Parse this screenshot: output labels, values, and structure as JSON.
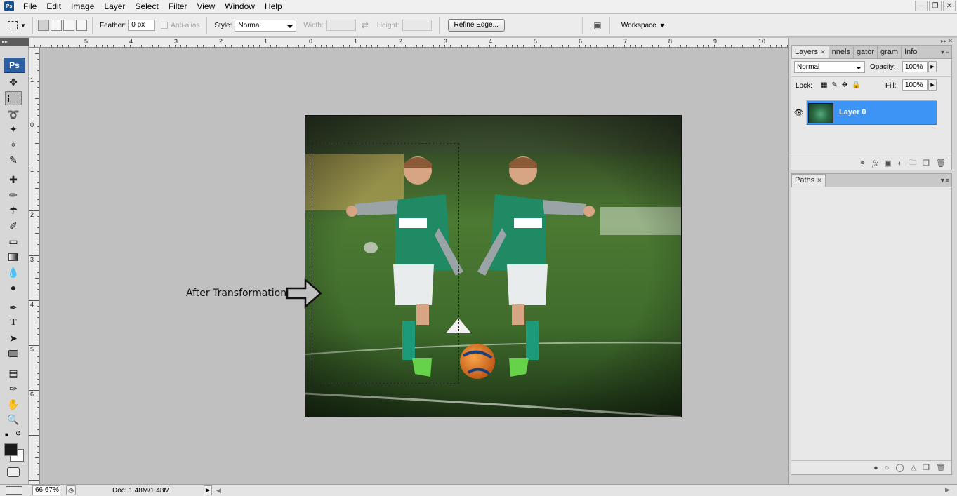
{
  "app": {
    "icon_label": "Ps"
  },
  "menu": [
    "File",
    "Edit",
    "Image",
    "Layer",
    "Select",
    "Filter",
    "View",
    "Window",
    "Help"
  ],
  "window_controls": [
    "minimize",
    "restore",
    "close"
  ],
  "options_bar": {
    "feather_label": "Feather:",
    "feather_value": "0 px",
    "antialias_label": "Anti-alias",
    "style_label": "Style:",
    "style_value": "Normal",
    "width_label": "Width:",
    "height_label": "Height:",
    "refine_label": "Refine Edge...",
    "workspace_label": "Workspace"
  },
  "toolbox": {
    "logo": "Ps",
    "tools": [
      "move-tool",
      "rectangular-marquee-tool",
      "lasso-tool",
      "magic-wand-tool",
      "crop-tool",
      "slice-tool",
      "healing-brush-tool",
      "brush-tool",
      "clone-stamp-tool",
      "history-brush-tool",
      "eraser-tool",
      "gradient-tool",
      "blur-tool",
      "dodge-tool",
      "pen-tool",
      "type-tool",
      "path-selection-tool",
      "shape-tool",
      "notes-tool",
      "eyedropper-tool",
      "hand-tool",
      "zoom-tool"
    ],
    "foreground_color": "#1a1a1a",
    "background_color": "#ffffff"
  },
  "rulers": {
    "top": [
      "5",
      "4",
      "3",
      "2",
      "1",
      "0",
      "1",
      "2",
      "3",
      "4",
      "5",
      "6",
      "7",
      "8",
      "9",
      "10"
    ],
    "left": [
      "1",
      "0",
      "1",
      "2",
      "3",
      "4",
      "5",
      "6"
    ]
  },
  "canvas": {
    "annotation": "After Transformation"
  },
  "status": {
    "zoom": "66.67%",
    "doc": "Doc: 1.48M/1.48M"
  },
  "layers_panel": {
    "tabs": [
      "Layers",
      "nnels",
      "gator",
      "gram",
      "Info"
    ],
    "blend_mode": "Normal",
    "opacity_label": "Opacity:",
    "opacity_value": "100%",
    "lock_label": "Lock:",
    "fill_label": "Fill:",
    "fill_value": "100%",
    "layer_name": "Layer 0"
  },
  "paths_panel": {
    "tab": "Paths"
  },
  "colors": {
    "selection": "#3d94f5",
    "jersey": "#1f8a63",
    "grass": "#3f6b2c"
  }
}
